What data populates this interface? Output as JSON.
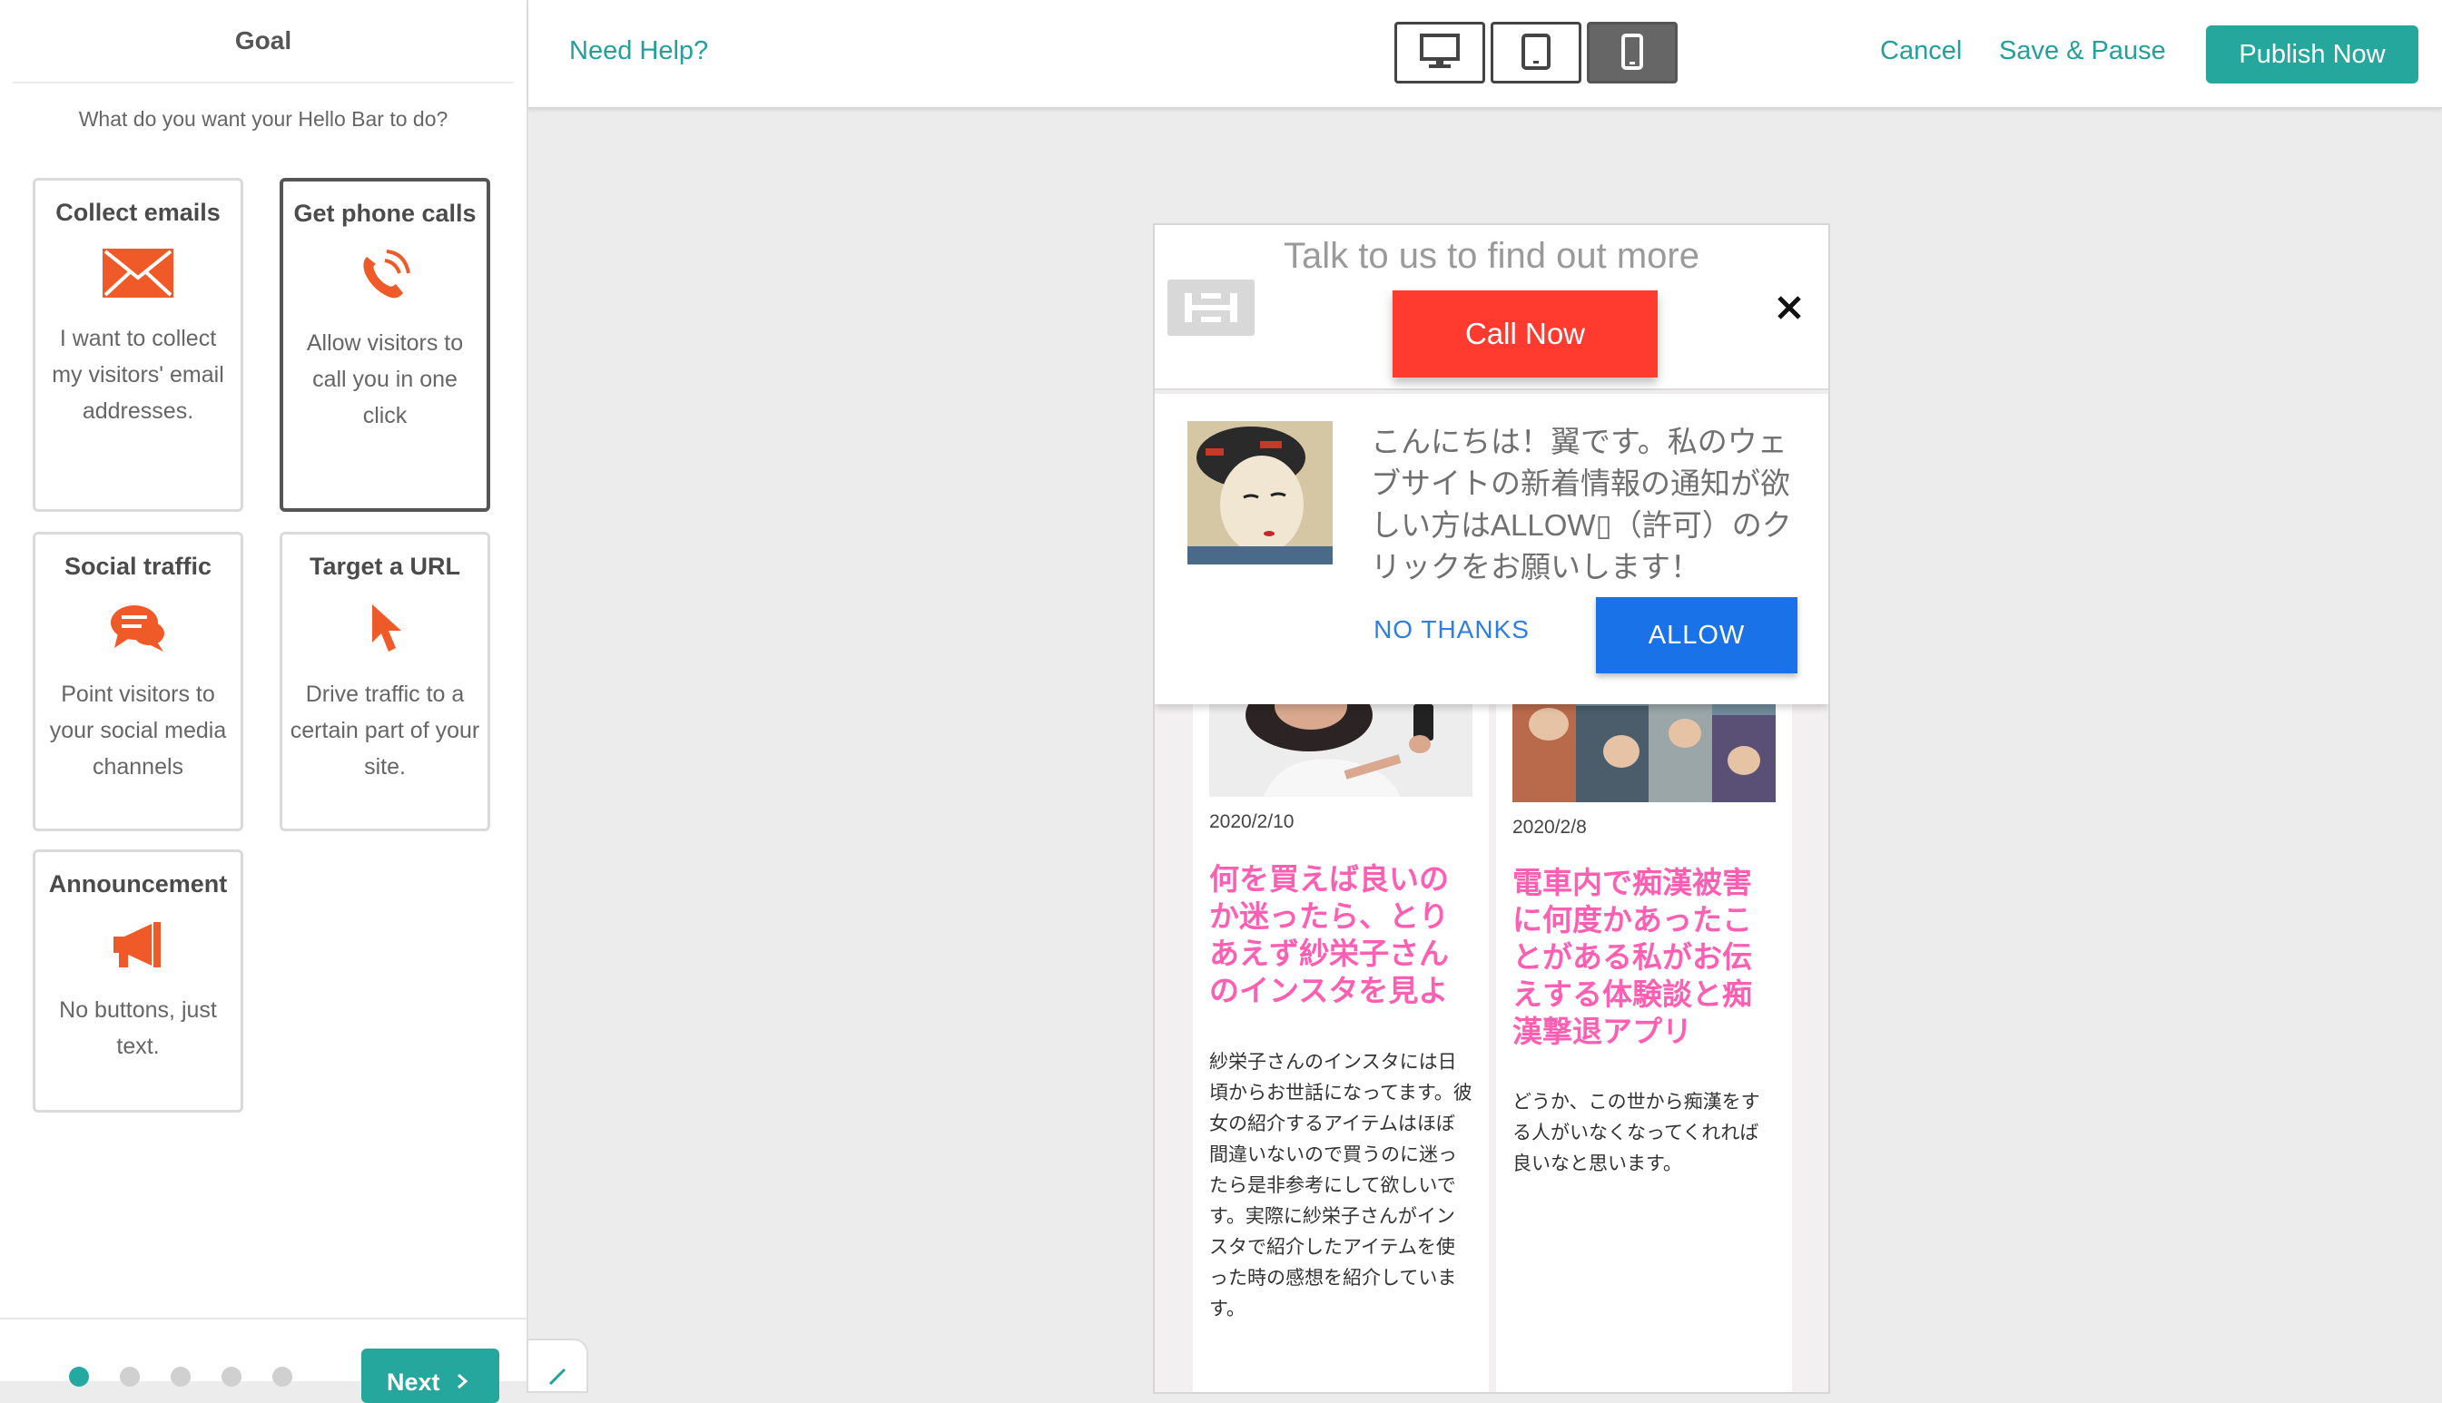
{
  "sidebar": {
    "title": "Goal",
    "question": "What do you want your Hello Bar to do?",
    "goals": [
      {
        "title": "Collect emails",
        "description": "I want to collect my visitors' email addresses.",
        "icon": "envelope-icon"
      },
      {
        "title": "Get phone calls",
        "description": "Allow visitors to call you in one click",
        "icon": "phone-icon",
        "selected": true
      },
      {
        "title": "Social traffic",
        "description": "Point visitors to your social media channels",
        "icon": "chat-bubbles-icon"
      },
      {
        "title": "Target a URL",
        "description": "Drive traffic to a certain part of your site.",
        "icon": "cursor-icon"
      },
      {
        "title": "Announcement",
        "description": "No buttons, just text.",
        "icon": "megaphone-icon"
      }
    ],
    "next_label": "Next",
    "steps_total": 5,
    "step_active": 1
  },
  "topbar": {
    "help": "Need Help?",
    "devices": [
      "desktop-icon",
      "tablet-icon",
      "mobile-icon"
    ],
    "active_device": "mobile",
    "cancel": "Cancel",
    "save_pause": "Save & Pause",
    "publish": "Publish Now"
  },
  "hellobar": {
    "headline": "Talk to us to find out more",
    "cta": "Call Now"
  },
  "push_prompt": {
    "message": "こんにちは！翼です。私のウェブサイトの新着情報の通知が欲しい方はALLOW▯（許可）のクリックをお願いします！",
    "no_thanks": "NO THANKS",
    "allow": "ALLOW"
  },
  "posts": [
    {
      "date": "2020/2/10",
      "title": "何を買えば良いのか迷ったら、とりあえず紗栄子さんのインスタを見よ",
      "body": "紗栄子さんのインスタには日頃からお世話になってます。彼女の紹介するアイテムはほぼ間違いないので買うのに迷ったら是非参考にして欲しいです。実際に紗栄子さんがインスタで紹介したアイテムを使った時の感想を紹介しています。"
    },
    {
      "date": "2020/2/8",
      "title": "電車内で痴漢被害に何度かあったことがある私がお伝えする体験談と痴漢撃退アプリ",
      "body": "どうか、この世から痴漢をする人がいなくなってくれれば良いなと思います。"
    }
  ],
  "colors": {
    "accent": "#25a79e",
    "brand_icon": "#f05a28",
    "cta": "#ff3b2f",
    "allow": "#1a72e8",
    "post_title": "#ff5fb3"
  }
}
